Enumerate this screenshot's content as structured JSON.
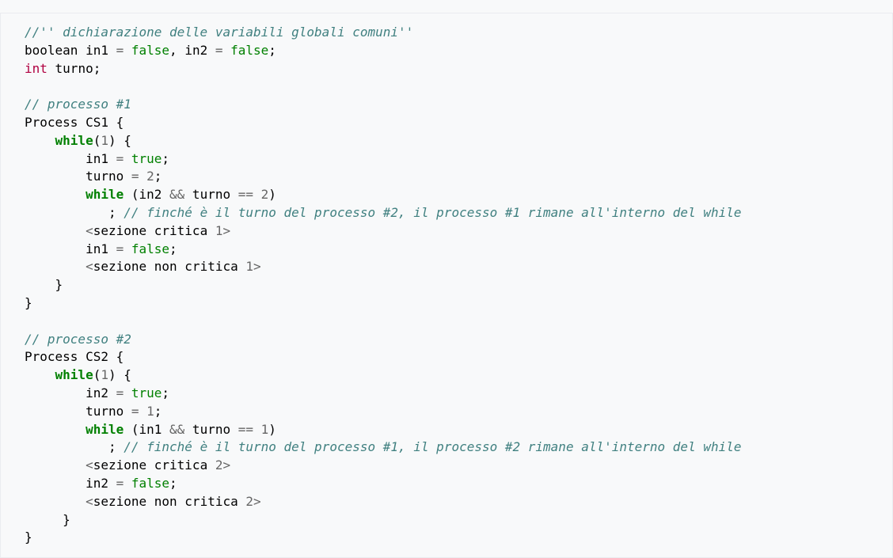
{
  "colors": {
    "background": "#f8f9fa",
    "comment": "#408080",
    "keyword": "#008000",
    "type": "#b00040",
    "boolean": "#008000",
    "number": "#666666",
    "operator": "#666666",
    "plain": "#000000"
  },
  "code": {
    "lines": [
      [
        {
          "t": "comment",
          "v": "//'' dichiarazione delle variabili globali comuni''"
        }
      ],
      [
        {
          "t": "plain",
          "v": "boolean in1 "
        },
        {
          "t": "op",
          "v": "="
        },
        {
          "t": "plain",
          "v": " "
        },
        {
          "t": "bool",
          "v": "false"
        },
        {
          "t": "plain",
          "v": ", in2 "
        },
        {
          "t": "op",
          "v": "="
        },
        {
          "t": "plain",
          "v": " "
        },
        {
          "t": "bool",
          "v": "false"
        },
        {
          "t": "plain",
          "v": ";"
        }
      ],
      [
        {
          "t": "type",
          "v": "int"
        },
        {
          "t": "plain",
          "v": " turno;"
        }
      ],
      [],
      [
        {
          "t": "comment",
          "v": "// processo #1"
        }
      ],
      [
        {
          "t": "plain",
          "v": "Process CS1 {"
        }
      ],
      [
        {
          "t": "plain",
          "v": "    "
        },
        {
          "t": "keyword",
          "v": "while"
        },
        {
          "t": "plain",
          "v": "("
        },
        {
          "t": "number",
          "v": "1"
        },
        {
          "t": "plain",
          "v": ") {"
        }
      ],
      [
        {
          "t": "plain",
          "v": "        in1 "
        },
        {
          "t": "op",
          "v": "="
        },
        {
          "t": "plain",
          "v": " "
        },
        {
          "t": "bool",
          "v": "true"
        },
        {
          "t": "plain",
          "v": ";"
        }
      ],
      [
        {
          "t": "plain",
          "v": "        turno "
        },
        {
          "t": "op",
          "v": "="
        },
        {
          "t": "plain",
          "v": " "
        },
        {
          "t": "number",
          "v": "2"
        },
        {
          "t": "plain",
          "v": ";"
        }
      ],
      [
        {
          "t": "plain",
          "v": "        "
        },
        {
          "t": "keyword",
          "v": "while"
        },
        {
          "t": "plain",
          "v": " (in2 "
        },
        {
          "t": "op",
          "v": "&&"
        },
        {
          "t": "plain",
          "v": " turno "
        },
        {
          "t": "op",
          "v": "=="
        },
        {
          "t": "plain",
          "v": " "
        },
        {
          "t": "number",
          "v": "2"
        },
        {
          "t": "plain",
          "v": ")"
        }
      ],
      [
        {
          "t": "plain",
          "v": "           ; "
        },
        {
          "t": "comment",
          "v": "// finché è il turno del processo #2, il processo #1 rimane all'interno del while"
        }
      ],
      [
        {
          "t": "plain",
          "v": "        "
        },
        {
          "t": "op",
          "v": "<"
        },
        {
          "t": "plain",
          "v": "sezione critica "
        },
        {
          "t": "number",
          "v": "1"
        },
        {
          "t": "op",
          "v": ">"
        }
      ],
      [
        {
          "t": "plain",
          "v": "        in1 "
        },
        {
          "t": "op",
          "v": "="
        },
        {
          "t": "plain",
          "v": " "
        },
        {
          "t": "bool",
          "v": "false"
        },
        {
          "t": "plain",
          "v": ";"
        }
      ],
      [
        {
          "t": "plain",
          "v": "        "
        },
        {
          "t": "op",
          "v": "<"
        },
        {
          "t": "plain",
          "v": "sezione non critica "
        },
        {
          "t": "number",
          "v": "1"
        },
        {
          "t": "op",
          "v": ">"
        }
      ],
      [
        {
          "t": "plain",
          "v": "    }"
        }
      ],
      [
        {
          "t": "plain",
          "v": "}"
        }
      ],
      [],
      [
        {
          "t": "comment",
          "v": "// processo #2"
        }
      ],
      [
        {
          "t": "plain",
          "v": "Process CS2 {"
        }
      ],
      [
        {
          "t": "plain",
          "v": "    "
        },
        {
          "t": "keyword",
          "v": "while"
        },
        {
          "t": "plain",
          "v": "("
        },
        {
          "t": "number",
          "v": "1"
        },
        {
          "t": "plain",
          "v": ") {"
        }
      ],
      [
        {
          "t": "plain",
          "v": "        in2 "
        },
        {
          "t": "op",
          "v": "="
        },
        {
          "t": "plain",
          "v": " "
        },
        {
          "t": "bool",
          "v": "true"
        },
        {
          "t": "plain",
          "v": ";"
        }
      ],
      [
        {
          "t": "plain",
          "v": "        turno "
        },
        {
          "t": "op",
          "v": "="
        },
        {
          "t": "plain",
          "v": " "
        },
        {
          "t": "number",
          "v": "1"
        },
        {
          "t": "plain",
          "v": ";"
        }
      ],
      [
        {
          "t": "plain",
          "v": "        "
        },
        {
          "t": "keyword",
          "v": "while"
        },
        {
          "t": "plain",
          "v": " (in1 "
        },
        {
          "t": "op",
          "v": "&&"
        },
        {
          "t": "plain",
          "v": " turno "
        },
        {
          "t": "op",
          "v": "=="
        },
        {
          "t": "plain",
          "v": " "
        },
        {
          "t": "number",
          "v": "1"
        },
        {
          "t": "plain",
          "v": ")"
        }
      ],
      [
        {
          "t": "plain",
          "v": "           ; "
        },
        {
          "t": "comment",
          "v": "// finché è il turno del processo #1, il processo #2 rimane all'interno del while"
        }
      ],
      [
        {
          "t": "plain",
          "v": "        "
        },
        {
          "t": "op",
          "v": "<"
        },
        {
          "t": "plain",
          "v": "sezione critica "
        },
        {
          "t": "number",
          "v": "2"
        },
        {
          "t": "op",
          "v": ">"
        }
      ],
      [
        {
          "t": "plain",
          "v": "        in2 "
        },
        {
          "t": "op",
          "v": "="
        },
        {
          "t": "plain",
          "v": " "
        },
        {
          "t": "bool",
          "v": "false"
        },
        {
          "t": "plain",
          "v": ";"
        }
      ],
      [
        {
          "t": "plain",
          "v": "        "
        },
        {
          "t": "op",
          "v": "<"
        },
        {
          "t": "plain",
          "v": "sezione non critica "
        },
        {
          "t": "number",
          "v": "2"
        },
        {
          "t": "op",
          "v": ">"
        }
      ],
      [
        {
          "t": "plain",
          "v": "     }"
        }
      ],
      [
        {
          "t": "plain",
          "v": "}"
        }
      ]
    ]
  }
}
